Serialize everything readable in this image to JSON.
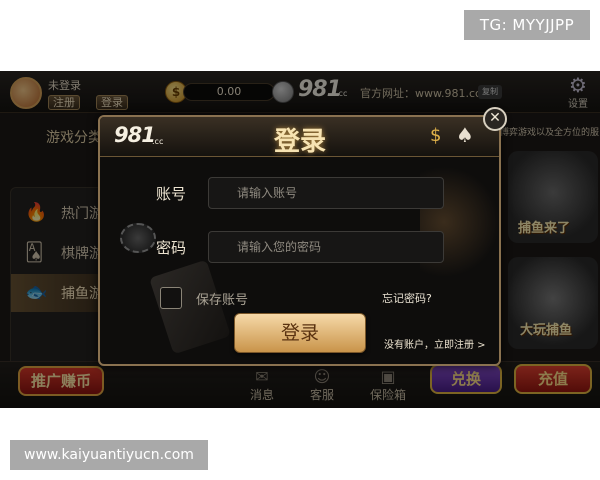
{
  "watermarks": {
    "telegram": "TG: MYYJJPP",
    "site": "www.kaiyuantiyucn.com"
  },
  "topbar": {
    "user_status": "未登录",
    "register_label": "注册",
    "login_label": "登录",
    "coin_symbol": "$",
    "balance": "0.00",
    "logo": "981",
    "logo_suffix": ".cc",
    "official_site": "官方网址：www.981.cc",
    "copy_label": "复制",
    "settings_label": "设置"
  },
  "sidebar": {
    "title": "游戏分类",
    "items": [
      {
        "icon": "🔥",
        "label": "热门游"
      },
      {
        "icon": "🂡",
        "label": "棋牌游"
      },
      {
        "icon": "🐟",
        "label": "捕鱼游"
      }
    ]
  },
  "right": {
    "banner_text": "博弈游戏以及全方位的服",
    "game1_label": "捕鱼来了",
    "game2_label": "大玩捕鱼"
  },
  "bottombar": {
    "promo_label": "推广赚币",
    "nav": [
      {
        "icon": "✉",
        "label": "消息"
      },
      {
        "icon": "☺",
        "label": "客服"
      },
      {
        "icon": "▣",
        "label": "保险箱"
      }
    ],
    "exchange_label": "兑换",
    "recharge_label": "充值"
  },
  "dialog": {
    "logo": "981",
    "logo_suffix": ".cc",
    "title": "登录",
    "account_label": "账号",
    "account_placeholder": "请输入账号",
    "password_label": "密码",
    "password_placeholder": "请输入您的密码",
    "remember_label": "保存账号",
    "forgot_label": "忘记密码?",
    "login_button": "登录",
    "register_link": "没有账户，立即注册 >",
    "close_symbol": "✕"
  },
  "colors": {
    "accent_gold": "#c9944a",
    "background": "#1c1916"
  }
}
